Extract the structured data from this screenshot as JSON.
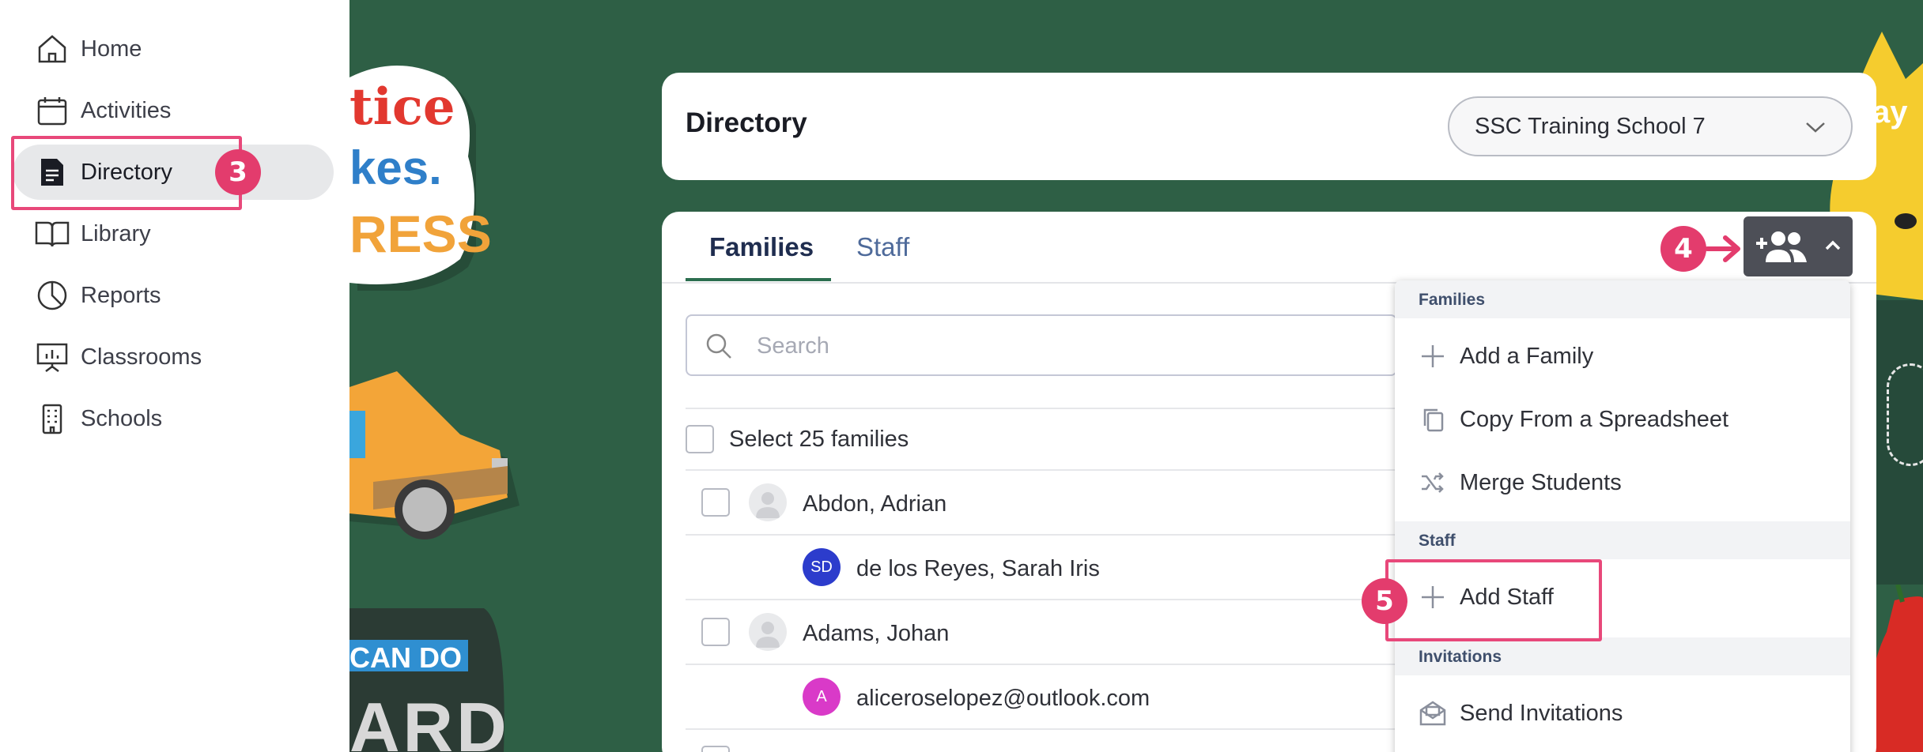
{
  "sidebar": {
    "items": [
      {
        "label": "Home",
        "icon": "home-icon"
      },
      {
        "label": "Activities",
        "icon": "calendar-icon"
      },
      {
        "label": "Directory",
        "icon": "document-icon"
      },
      {
        "label": "Library",
        "icon": "book-icon"
      },
      {
        "label": "Reports",
        "icon": "pie-chart-icon"
      },
      {
        "label": "Classrooms",
        "icon": "presentation-icon"
      },
      {
        "label": "Schools",
        "icon": "building-icon"
      }
    ]
  },
  "steps": {
    "s3": "3",
    "s4": "4",
    "s5": "5"
  },
  "header": {
    "title": "Directory",
    "school_select": "SSC Training School 7"
  },
  "tabs": {
    "families": "Families",
    "staff": "Staff"
  },
  "search": {
    "placeholder": "Search"
  },
  "list": {
    "select_all": "Select 25 families",
    "rows": [
      {
        "name": "Abdon, Adrian"
      },
      {
        "name": "de los Reyes, Sarah Iris",
        "initials": "SD"
      },
      {
        "name": "Adams, Johan"
      },
      {
        "name": "aliceroselopez@outlook.com",
        "initials": "A"
      }
    ]
  },
  "menu": {
    "families_header": "Families",
    "add_family": "Add a Family",
    "copy_spreadsheet": "Copy From a Spreadsheet",
    "merge_students": "Merge Students",
    "staff_header": "Staff",
    "add_staff": "Add Staff",
    "invitations_header": "Invitations",
    "send_invitations": "Send Invitations"
  },
  "stickers": {
    "s1a": "tice",
    "s1b": "kes.",
    "s1c": "RESS",
    "s2": "CAN DO",
    "s3": "ARD",
    "s4": "ay"
  },
  "colors": {
    "accent": "#e33c6d",
    "tab_underline": "#2c6e4f",
    "background": "#2e5f45",
    "avatar_sd": "#2c3ccc",
    "avatar_a": "#d93ac8"
  }
}
